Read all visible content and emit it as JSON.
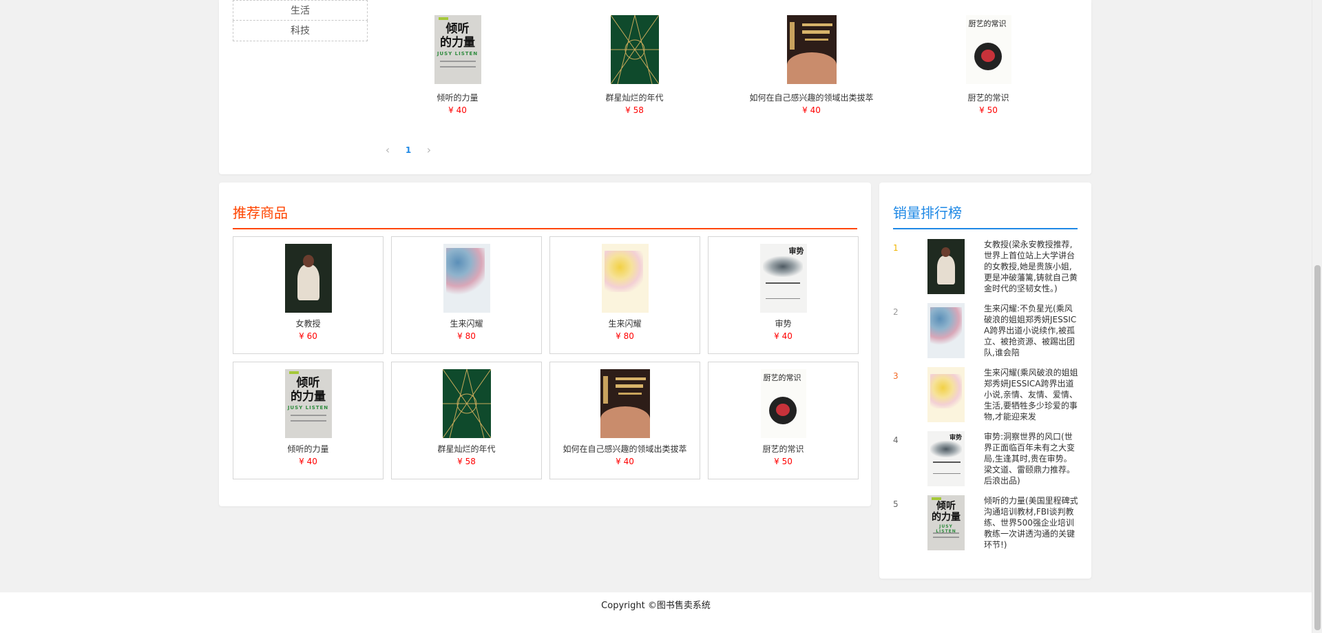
{
  "categories": [
    "生活",
    "科技"
  ],
  "top_books": [
    {
      "title": "倾听的力量",
      "price": "¥ 40",
      "cover": "listen"
    },
    {
      "title": "群星灿烂的年代",
      "price": "¥ 58",
      "cover": "green"
    },
    {
      "title": "如何在自己感兴趣的领域出类拔萃",
      "price": "¥ 40",
      "cover": "dark"
    },
    {
      "title": "厨艺的常识",
      "price": "¥ 50",
      "cover": "cook"
    }
  ],
  "pagination": {
    "prev": "‹",
    "current": "1",
    "next": "›"
  },
  "recommend": {
    "title": "推荐商品",
    "items": [
      {
        "title": "女教授",
        "price": "¥ 60",
        "cover": "lady"
      },
      {
        "title": "生来闪耀",
        "price": "¥ 80",
        "cover": "blue"
      },
      {
        "title": "生来闪耀",
        "price": "¥ 80",
        "cover": "yellow"
      },
      {
        "title": "审势",
        "price": "¥ 40",
        "cover": "ink"
      },
      {
        "title": "倾听的力量",
        "price": "¥ 40",
        "cover": "listen"
      },
      {
        "title": "群星灿烂的年代",
        "price": "¥ 58",
        "cover": "green"
      },
      {
        "title": "如何在自己感兴趣的领域出类拔萃",
        "price": "¥ 40",
        "cover": "dark"
      },
      {
        "title": "厨艺的常识",
        "price": "¥ 50",
        "cover": "cook"
      }
    ]
  },
  "ranking": {
    "title": "销量排行榜",
    "items": [
      {
        "rank": "1",
        "desc": "女教授(梁永安教授推荐,世界上首位站上大学讲台的女教授,她是贵族小姐,更是冲破藩篱,铸就自己黄金时代的坚韧女性。)",
        "cover": "lady"
      },
      {
        "rank": "2",
        "desc": "生来闪耀:不负星光(乘风破浪的姐姐郑秀妍JESSICA跨界出道小说续作,被孤立、被抢资源、被踢出团队,谁会陪",
        "cover": "blue"
      },
      {
        "rank": "3",
        "desc": "生来闪耀(乘风破浪的姐姐郑秀妍JESSICA跨界出道小说,亲情、友情、爱情、生活,要牺牲多少珍爱的事物,才能迎来发",
        "cover": "yellow"
      },
      {
        "rank": "4",
        "desc": "审势:洞察世界的风口(世界正面临百年未有之大变局,生逢其时,贵在审势。梁文道、雷颐鼎力推荐。后浪出品)",
        "cover": "ink"
      },
      {
        "rank": "5",
        "desc": "倾听的力量(美国里程碑式沟通培训教材,FBI谈判教练、世界500强企业培训教练一次讲透沟通的关键环节!)",
        "cover": "listen"
      }
    ]
  },
  "cover_text": {
    "listen_title": "倾听\n的力量",
    "listen_sub": "JUSY LISTEN",
    "cook_title": "厨艺的常识",
    "ink_title": "审势"
  },
  "footer": {
    "copyright": "Copyright ©图书售卖系统"
  },
  "colors": {
    "accent_red": "#ff4500",
    "accent_blue": "#1e88e5",
    "price": "#ff0000"
  }
}
